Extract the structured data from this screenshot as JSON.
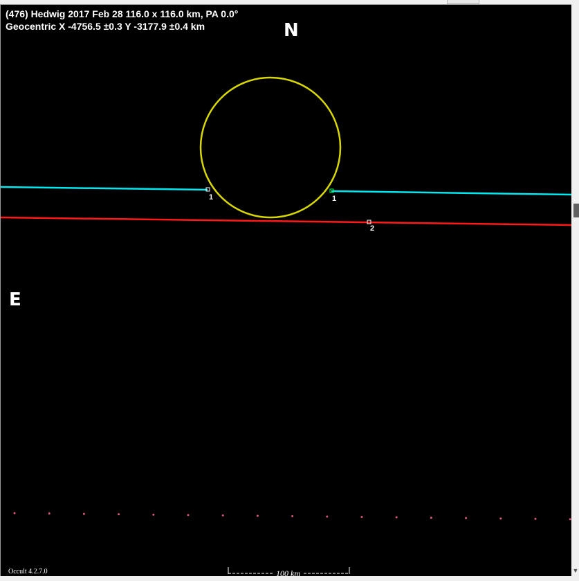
{
  "header": {
    "title_line": "(476) Hedwig  2017 Feb 28   116.0 x 116.0 km,  PA 0.0°",
    "geocentric_line": "Geocentric  X  -4756.5 ±0.3  Y -3177.9 ±0.4 km"
  },
  "compass": {
    "north": "N",
    "east": "E"
  },
  "chords": [
    {
      "id": "1",
      "color": "#00e8f0",
      "label_left": "1",
      "label_right": "1"
    },
    {
      "id": "2",
      "color": "#ff1a1a",
      "label": "2"
    }
  ],
  "profile": {
    "color": "#d8d800"
  },
  "scale_bar": {
    "label": "100 km"
  },
  "footer": {
    "version": "Occult 4.2.7.0"
  },
  "colors": {
    "background": "#000000",
    "text": "#ffffff",
    "dots": "#d85a7a"
  }
}
